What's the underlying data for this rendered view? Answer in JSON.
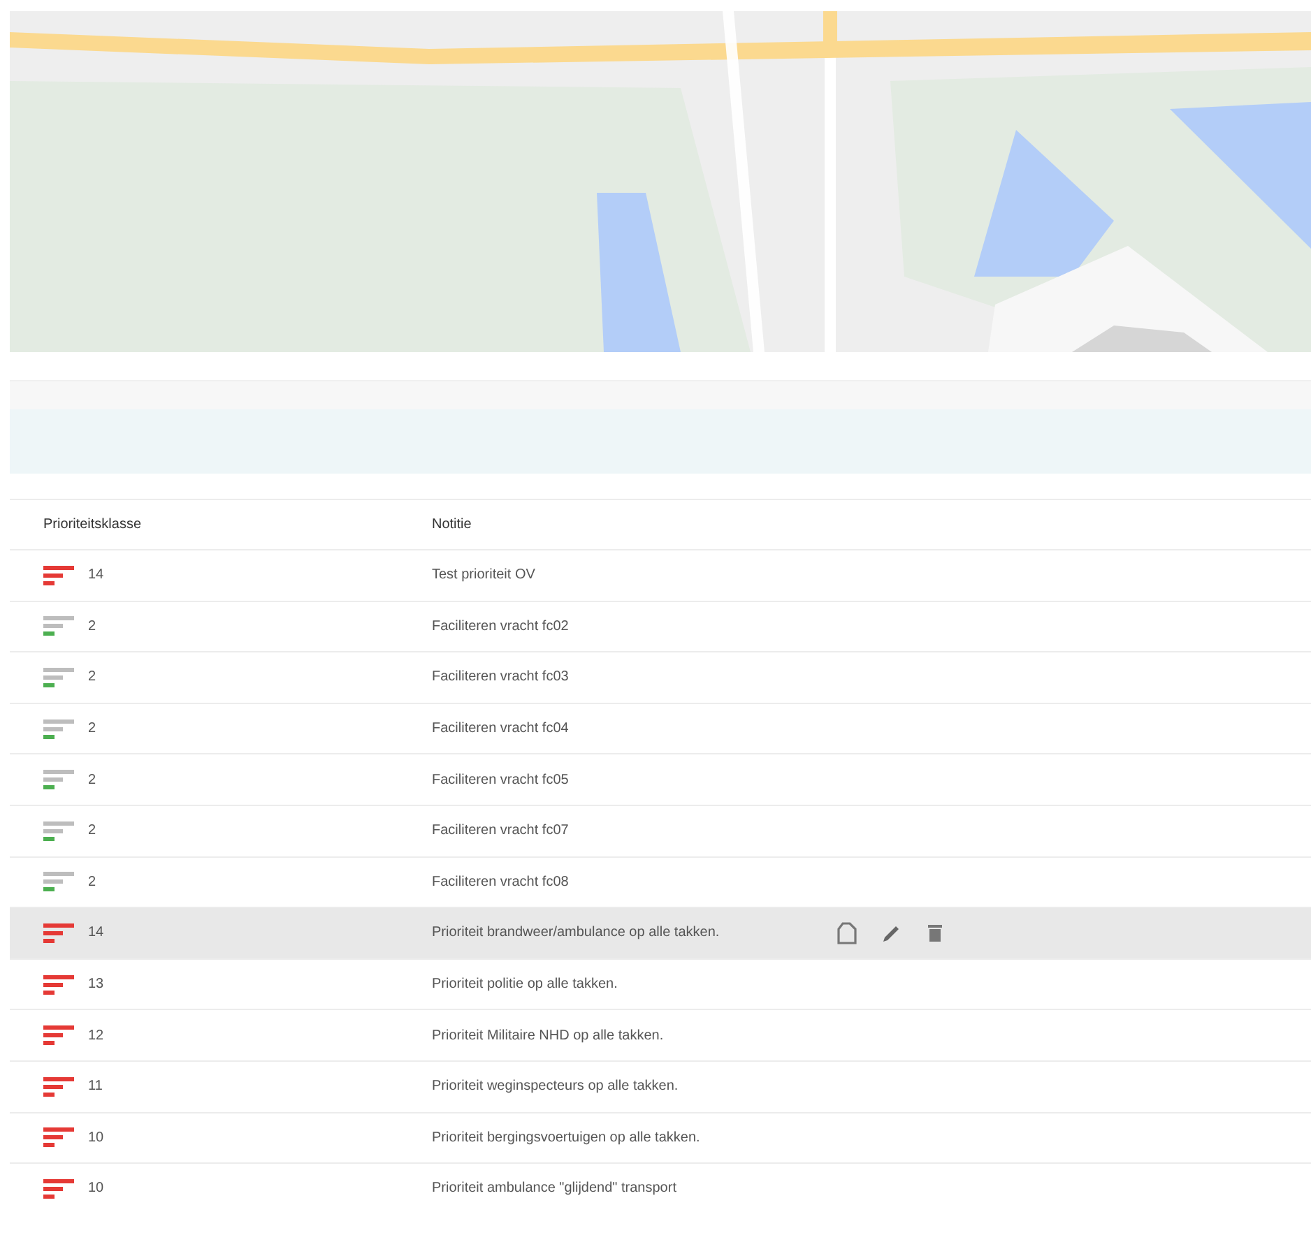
{
  "table": {
    "columns": [
      "Prioriteitsklasse",
      "Notitie"
    ],
    "rows": [
      {
        "priority": "14",
        "kind": "high",
        "note": "Test prioriteit OV",
        "selected": false
      },
      {
        "priority": "2",
        "kind": "low",
        "note": "Faciliteren vracht fc02",
        "selected": false
      },
      {
        "priority": "2",
        "kind": "low",
        "note": "Faciliteren vracht fc03",
        "selected": false
      },
      {
        "priority": "2",
        "kind": "low",
        "note": "Faciliteren vracht fc04",
        "selected": false
      },
      {
        "priority": "2",
        "kind": "low",
        "note": "Faciliteren vracht fc05",
        "selected": false
      },
      {
        "priority": "2",
        "kind": "low",
        "note": "Faciliteren vracht fc07",
        "selected": false
      },
      {
        "priority": "2",
        "kind": "low",
        "note": "Faciliteren vracht fc08",
        "selected": false
      },
      {
        "priority": "14",
        "kind": "high",
        "note": "Prioriteit brandweer/ambulance op alle takken.",
        "selected": true
      },
      {
        "priority": "13",
        "kind": "high",
        "note": "Prioriteit politie op alle takken.",
        "selected": false
      },
      {
        "priority": "12",
        "kind": "high",
        "note": "Prioriteit Militaire NHD op alle takken.",
        "selected": false
      },
      {
        "priority": "11",
        "kind": "high",
        "note": "Prioriteit weginspecteurs op alle takken.",
        "selected": false
      },
      {
        "priority": "10",
        "kind": "high",
        "note": "Prioriteit bergingsvoertuigen op alle takken.",
        "selected": false
      },
      {
        "priority": "10",
        "kind": "high",
        "note": "Prioriteit ambulance \"glijdend\" transport",
        "selected": false
      }
    ]
  }
}
